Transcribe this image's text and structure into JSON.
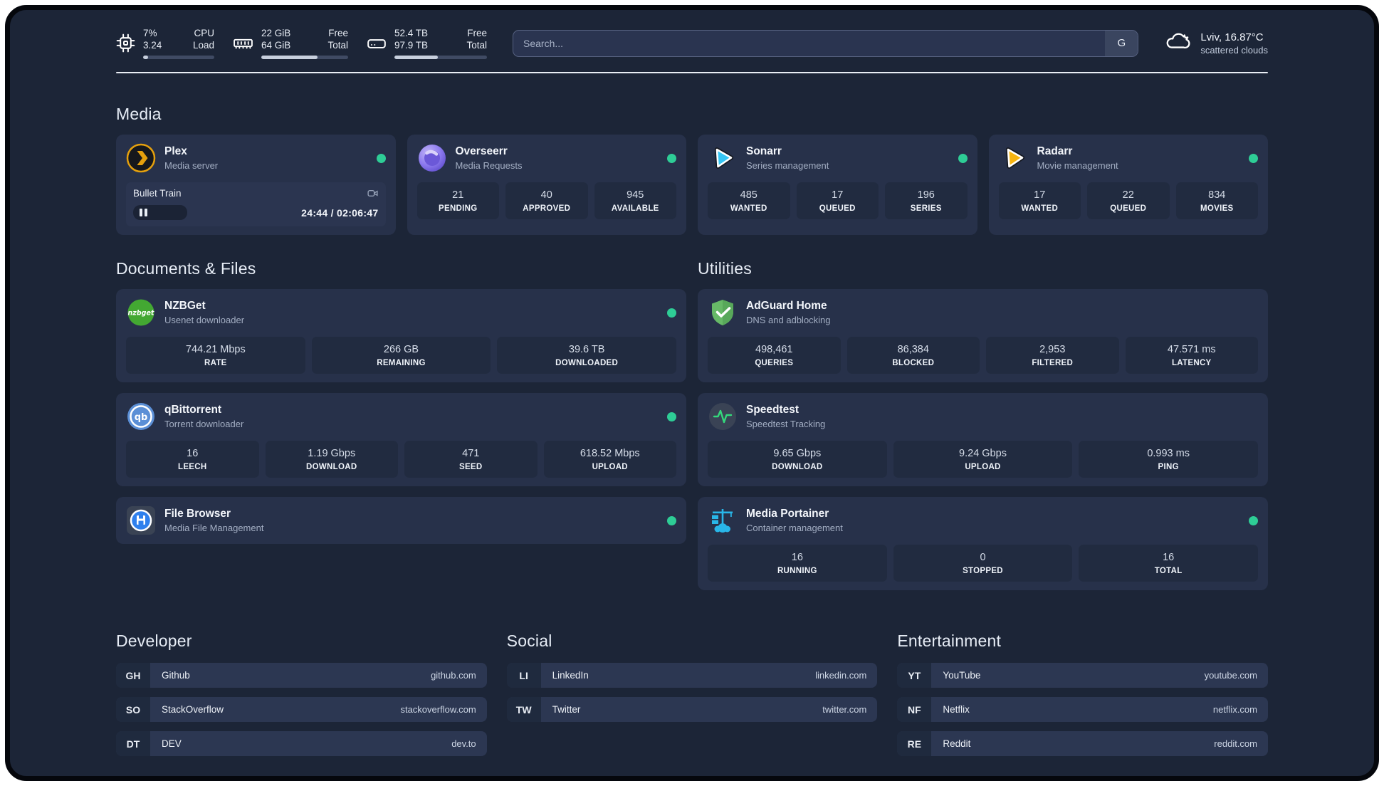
{
  "topbar": {
    "stats": [
      {
        "icon": "cpu-icon",
        "v1": "7%",
        "l1": "CPU",
        "v2": "3.24",
        "l2": "Load",
        "pct": 7
      },
      {
        "icon": "memory-icon",
        "v1": "22 GiB",
        "l1": "Free",
        "v2": "64 GiB",
        "l2": "Total",
        "pct": 65
      },
      {
        "icon": "disk-icon",
        "v1": "52.4 TB",
        "l1": "Free",
        "v2": "97.9 TB",
        "l2": "Total",
        "pct": 47
      }
    ],
    "search": {
      "placeholder": "Search...",
      "button_label": "G"
    },
    "weather": {
      "title": "Lviv, 16.87°C",
      "subtitle": "scattered clouds"
    }
  },
  "sections": {
    "media": {
      "title": "Media",
      "plex": {
        "name": "Plex",
        "desc": "Media server",
        "now_playing": "Bullet Train",
        "time": "24:44 / 02:06:47",
        "progress_pct": 22
      },
      "overseerr": {
        "name": "Overseerr",
        "desc": "Media Requests",
        "stats": [
          {
            "value": "21",
            "label": "PENDING"
          },
          {
            "value": "40",
            "label": "APPROVED"
          },
          {
            "value": "945",
            "label": "AVAILABLE"
          }
        ]
      },
      "sonarr": {
        "name": "Sonarr",
        "desc": "Series management",
        "stats": [
          {
            "value": "485",
            "label": "WANTED"
          },
          {
            "value": "17",
            "label": "QUEUED"
          },
          {
            "value": "196",
            "label": "SERIES"
          }
        ]
      },
      "radarr": {
        "name": "Radarr",
        "desc": "Movie management",
        "stats": [
          {
            "value": "17",
            "label": "WANTED"
          },
          {
            "value": "22",
            "label": "QUEUED"
          },
          {
            "value": "834",
            "label": "MOVIES"
          }
        ]
      }
    },
    "documents": {
      "title": "Documents & Files",
      "nzbget": {
        "name": "NZBGet",
        "desc": "Usenet downloader",
        "stats": [
          {
            "value": "744.21 Mbps",
            "label": "RATE"
          },
          {
            "value": "266 GB",
            "label": "REMAINING"
          },
          {
            "value": "39.6 TB",
            "label": "DOWNLOADED"
          }
        ]
      },
      "qbittorrent": {
        "name": "qBittorrent",
        "desc": "Torrent downloader",
        "stats": [
          {
            "value": "16",
            "label": "LEECH"
          },
          {
            "value": "1.19 Gbps",
            "label": "DOWNLOAD"
          },
          {
            "value": "471",
            "label": "SEED"
          },
          {
            "value": "618.52 Mbps",
            "label": "UPLOAD"
          }
        ]
      },
      "filebrowser": {
        "name": "File Browser",
        "desc": "Media File Management"
      }
    },
    "utilities": {
      "title": "Utilities",
      "adguard": {
        "name": "AdGuard Home",
        "desc": "DNS and adblocking",
        "stats": [
          {
            "value": "498,461",
            "label": "QUERIES"
          },
          {
            "value": "86,384",
            "label": "BLOCKED"
          },
          {
            "value": "2,953",
            "label": "FILTERED"
          },
          {
            "value": "47.571 ms",
            "label": "LATENCY"
          }
        ]
      },
      "speedtest": {
        "name": "Speedtest",
        "desc": "Speedtest Tracking",
        "stats": [
          {
            "value": "9.65 Gbps",
            "label": "DOWNLOAD"
          },
          {
            "value": "9.24 Gbps",
            "label": "UPLOAD"
          },
          {
            "value": "0.993 ms",
            "label": "PING"
          }
        ]
      },
      "portainer": {
        "name": "Media Portainer",
        "desc": "Container management",
        "stats": [
          {
            "value": "16",
            "label": "RUNNING"
          },
          {
            "value": "0",
            "label": "STOPPED"
          },
          {
            "value": "16",
            "label": "TOTAL"
          }
        ]
      }
    },
    "links": {
      "developer": {
        "title": "Developer",
        "items": [
          {
            "tag": "GH",
            "name": "Github",
            "url": "github.com"
          },
          {
            "tag": "SO",
            "name": "StackOverflow",
            "url": "stackoverflow.com"
          },
          {
            "tag": "DT",
            "name": "DEV",
            "url": "dev.to"
          }
        ]
      },
      "social": {
        "title": "Social",
        "items": [
          {
            "tag": "LI",
            "name": "LinkedIn",
            "url": "linkedin.com"
          },
          {
            "tag": "TW",
            "name": "Twitter",
            "url": "twitter.com"
          }
        ]
      },
      "entertainment": {
        "title": "Entertainment",
        "items": [
          {
            "tag": "YT",
            "name": "YouTube",
            "url": "youtube.com"
          },
          {
            "tag": "NF",
            "name": "Netflix",
            "url": "netflix.com"
          },
          {
            "tag": "RE",
            "name": "Reddit",
            "url": "reddit.com"
          }
        ]
      }
    }
  },
  "colors": {
    "status_online": "#2ecd96",
    "accent_blue": "#35c5f4",
    "accent_orange": "#e5a00d"
  }
}
